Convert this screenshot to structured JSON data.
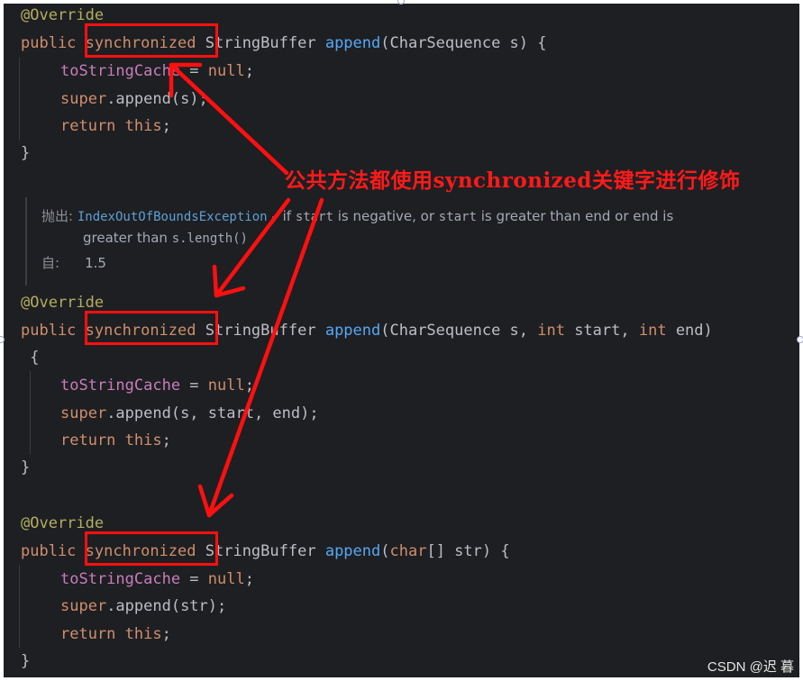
{
  "editor": {
    "block1": {
      "annotation": "@Override",
      "kw_public": "public",
      "kw_synchronized": "synchronized",
      "ret_type": "StringBuffer",
      "method": "append",
      "params": "(CharSequence s) {",
      "line2_field": "toStringCache",
      "line2_assign": " = ",
      "line2_null": "null",
      "line2_end": ";",
      "line3_super": "super",
      "line3_call": ".append(s);",
      "line4_return": "return",
      "line4_this": "this",
      "line4_end": ";",
      "close": "}"
    },
    "javadoc": {
      "throws_label": "抛出:",
      "exception": "IndexOutOfBoundsException",
      "dash": " – if ",
      "code_start": "start",
      "mid1": " is negative, or ",
      "code_start2": "start",
      "mid2": " is greater than end or end is",
      "line2_prefix": "greater than ",
      "code_slength": "s.length",
      "line2_end": "()",
      "since_label": "自:",
      "since_value": "1.5"
    },
    "block2": {
      "annotation": "@Override",
      "kw_public": "public",
      "kw_synchronized": "synchronized",
      "ret_type": "StringBuffer",
      "method": "append",
      "params_open": "(CharSequence s, ",
      "kw_int1": "int",
      "param_start": " start, ",
      "kw_int2": "int",
      "param_end": " end)",
      "open_brace": " {",
      "line2_field": "toStringCache",
      "line2_assign": " = ",
      "line2_null": "null",
      "line2_end": ";",
      "line3_super": "super",
      "line3_call": ".append(s, start, end);",
      "line4_return": "return",
      "line4_this": "this",
      "line4_end": ";",
      "close": "}"
    },
    "block3": {
      "annotation": "@Override",
      "kw_public": "public",
      "kw_synchronized": "synchronized",
      "ret_type": "StringBuffer",
      "method": "append",
      "paren_open": "(",
      "kw_char": "char",
      "params_rest": "[] str) {",
      "line2_field": "toStringCache",
      "line2_assign": " = ",
      "line2_null": "null",
      "line2_end": ";",
      "line3_super": "super",
      "line3_call": ".append(str);",
      "line4_return": "return",
      "line4_this": "this",
      "line4_end": ";",
      "close": "}"
    }
  },
  "annotation_text": "公共方法都使用synchronized关键字进行修饰",
  "watermark": "CSDN @迟 暮",
  "colors": {
    "background": "#1e1f22",
    "keyword": "#cf8e6d",
    "method": "#56a8f5",
    "field": "#c77dbb",
    "annotation": "#b3ae60",
    "text": "#bcbec4",
    "highlight_red": "#ff1010"
  }
}
